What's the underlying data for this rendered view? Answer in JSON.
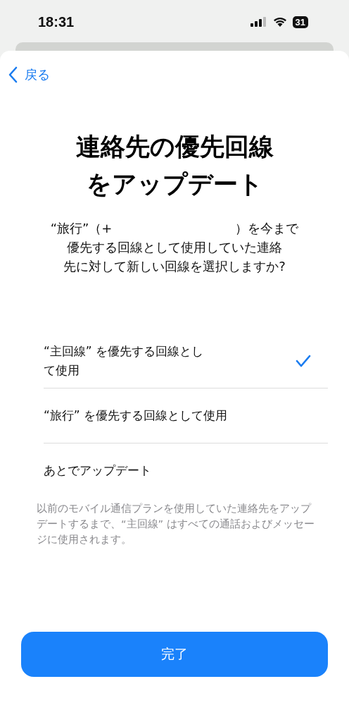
{
  "status_bar": {
    "time": "18:31",
    "battery": "31"
  },
  "nav": {
    "back": "戻る"
  },
  "title_lines": [
    "連絡先の優先回線",
    "をアップデート"
  ],
  "description": {
    "before_gap": "“旅行”（+",
    "after_gap": "）を今まで",
    "lines": [
      "優先する回線として使用していた連絡",
      "先に対して新しい回線を選択しますか?"
    ]
  },
  "options": [
    {
      "label": "“主回線” を優先する回線として使用",
      "selected": true
    },
    {
      "label": "“旅行” を優先する回線として使用",
      "selected": false
    },
    {
      "label": "あとでアップデート",
      "selected": false
    }
  ],
  "footnote": "以前のモバイル通信プランを使用していた連絡先をアップデートするまで、“主回線” はすべての通話およびメッセージに使用されます。",
  "done_button": "完了"
}
